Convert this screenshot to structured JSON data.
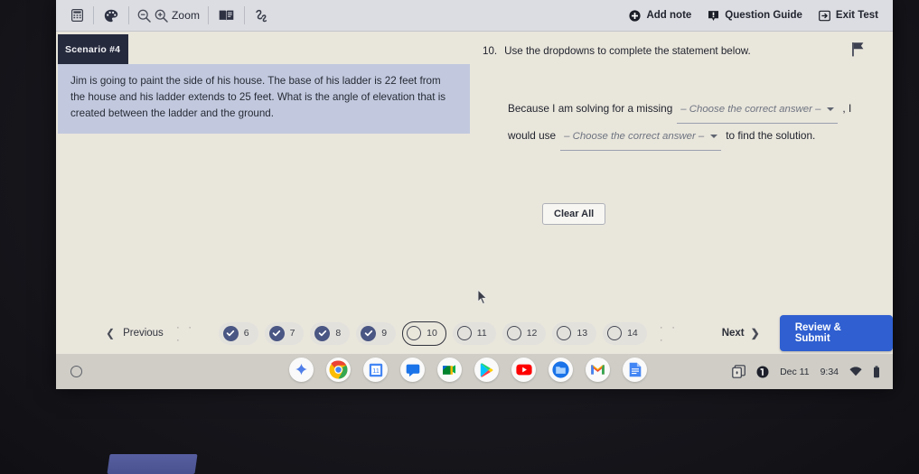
{
  "toolbar": {
    "tools": [
      {
        "name": "calculator-icon",
        "label": "Calculator"
      },
      {
        "name": "palette-icon",
        "label": "Color Contrast"
      },
      {
        "name": "dictionary-icon",
        "label": "Dictionary"
      },
      {
        "name": "line-reader-icon",
        "label": "Line Reader"
      }
    ],
    "zoom_out_icon": "zoom-out-icon",
    "zoom_in_icon": "zoom-in-icon",
    "zoom_label": "Zoom",
    "add_note_label": "Add note",
    "add_note_icon": "plus-circle-icon",
    "question_guide_label": "Question Guide",
    "question_guide_icon": "guide-icon",
    "exit_test_label": "Exit Test",
    "exit_test_icon": "exit-icon"
  },
  "scenario": {
    "tab_label": "Scenario #4",
    "text": "Jim is going to paint the side of his house. The base of his ladder is 22 feet from the house and his ladder extends to 25 feet. What is the angle of elevation that is created between the ladder and the ground.",
    "flag_icon": "flag-icon"
  },
  "question": {
    "number": "10.",
    "prompt": "Use the dropdowns to complete the statement below.",
    "statement": {
      "part1": "Because I am solving for a missing",
      "dropdown1": "– Choose the correct answer –",
      "part2": ", I",
      "part3": "would use",
      "dropdown2": "– Choose the correct answer –",
      "part4": "to find the solution."
    },
    "clear_all_label": "Clear All"
  },
  "nav": {
    "previous_label": "Previous",
    "next_label": "Next",
    "review_label": "Review & Submit",
    "leading_ellipsis": "· · ·",
    "trailing_ellipsis": "· · ·",
    "items": [
      {
        "number": "6",
        "state": "answered"
      },
      {
        "number": "7",
        "state": "answered"
      },
      {
        "number": "8",
        "state": "answered"
      },
      {
        "number": "9",
        "state": "answered"
      },
      {
        "number": "10",
        "state": "current"
      },
      {
        "number": "11",
        "state": "unanswered"
      },
      {
        "number": "12",
        "state": "unanswered"
      },
      {
        "number": "13",
        "state": "unanswered"
      },
      {
        "number": "14",
        "state": "unanswered"
      }
    ]
  },
  "shelf": {
    "launcher_icon": "launcher-circle-icon",
    "apps": [
      {
        "name": "gemini-icon"
      },
      {
        "name": "chrome-icon"
      },
      {
        "name": "calendar-icon"
      },
      {
        "name": "chat-icon"
      },
      {
        "name": "meet-icon"
      },
      {
        "name": "play-store-icon"
      },
      {
        "name": "youtube-icon"
      },
      {
        "name": "files-icon"
      },
      {
        "name": "gmail-icon"
      },
      {
        "name": "docs-icon"
      }
    ],
    "tray": {
      "screenshot_icon": "screen-capture-icon",
      "notification_icon": "notification-badge-icon",
      "date": "Dec 11",
      "time": "9:34",
      "wifi_icon": "wifi-icon",
      "battery_icon": "battery-icon"
    }
  },
  "colors": {
    "accent_blue": "#2f5fd0",
    "scenario_tab": "#262a3d",
    "scenario_body": "#c2c9de",
    "check_fill": "#4a5683",
    "page_bg": "#e9e6dc"
  }
}
